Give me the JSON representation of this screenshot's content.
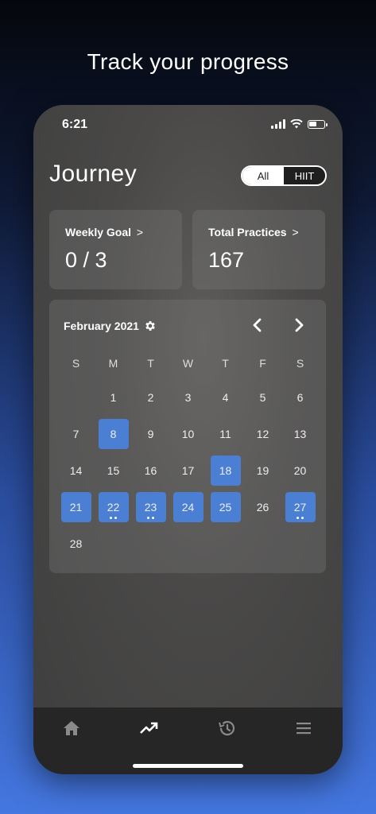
{
  "headline": "Track your progress",
  "status_bar": {
    "time": "6:21"
  },
  "header": {
    "title": "Journey",
    "toggle": {
      "options": [
        "All",
        "HIIT"
      ],
      "selected": "All"
    }
  },
  "stats": [
    {
      "label": "Weekly Goal",
      "chevron": ">",
      "value": "0 / 3"
    },
    {
      "label": "Total Practices",
      "chevron": ">",
      "value": "167"
    }
  ],
  "calendar": {
    "month": "February 2021",
    "weekdays": [
      "S",
      "M",
      "T",
      "W",
      "T",
      "F",
      "S"
    ],
    "weeks": [
      [
        null,
        "1",
        "2",
        "3",
        "4",
        "5",
        "6"
      ],
      [
        "7",
        "8",
        "9",
        "10",
        "11",
        "12",
        "13"
      ],
      [
        "14",
        "15",
        "16",
        "17",
        "18",
        "19",
        "20"
      ],
      [
        "21",
        "22",
        "23",
        "24",
        "25",
        "26",
        "27"
      ],
      [
        "28",
        null,
        null,
        null,
        null,
        null,
        null
      ]
    ],
    "completed_days": [
      "8",
      "18",
      "21",
      "22",
      "23",
      "24",
      "25",
      "27"
    ],
    "multi_session_days": [
      "22",
      "23",
      "27"
    ],
    "accent_color": "#4a7fd3"
  },
  "tab_bar": {
    "items": [
      {
        "icon": "home-icon",
        "active": false
      },
      {
        "icon": "trending-up-icon",
        "active": true
      },
      {
        "icon": "history-icon",
        "active": false
      },
      {
        "icon": "menu-icon",
        "active": false
      }
    ]
  }
}
